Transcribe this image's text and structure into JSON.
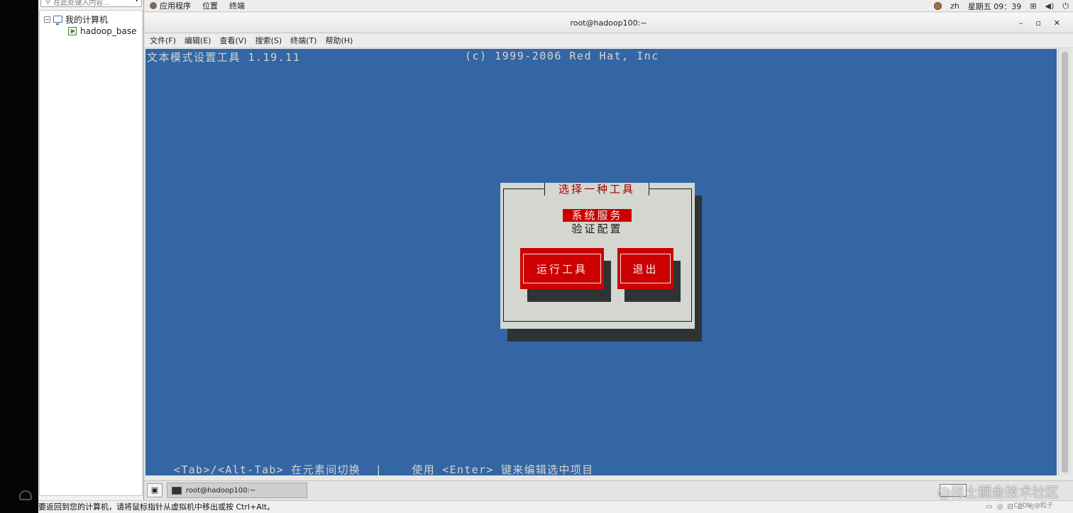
{
  "vmware": {
    "search_placeholder": "在此处键入内容...",
    "tree": {
      "root_label": "我的计算机",
      "vm_label": "hadoop_base"
    },
    "status_text": "要返回到您的计算机，请将鼠标指针从虚拟机中移出或按 Ctrl+Alt。"
  },
  "panel": {
    "applications": "应用程序",
    "places": "位置",
    "terminal": "终端",
    "lang": "zh",
    "clock": "星期五 09：39"
  },
  "terminal": {
    "title": "root@hadoop100:~",
    "menu": [
      "文件(F)",
      "编辑(E)",
      "查看(V)",
      "搜索(S)",
      "终端(T)",
      "帮助(H)"
    ]
  },
  "tui": {
    "header_left": "文本模式设置工具 1.19.11",
    "header_right": "(c) 1999-2006 Red Hat, Inc",
    "dialog_title": "选择一种工具",
    "items": [
      "系统服务",
      "验证配置"
    ],
    "selected_index": 0,
    "buttons": {
      "run": "运行工具",
      "quit": "退出"
    },
    "footer": "<Tab>/<Alt-Tab> 在元素间切换  |    使用 <Enter> 键来编辑选中项目"
  },
  "taskbar": {
    "item_label": "root@hadoop100:~"
  },
  "watermark": {
    "main": "@稀土掘金技术社区",
    "small": "CSDN @粒子"
  },
  "colors": {
    "terminal_bg": "#3465a4",
    "dialog_bg": "#d3d7cf",
    "accent_red": "#cc0000",
    "shadow": "#2e3436"
  }
}
